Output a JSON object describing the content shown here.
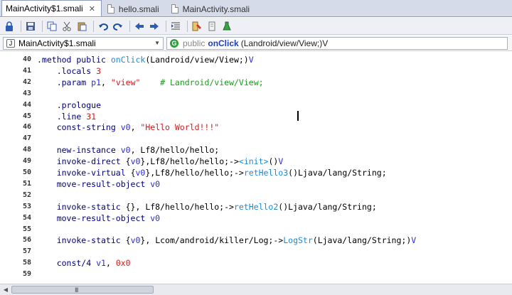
{
  "tabs": [
    {
      "label": "MainActivity$1.smali",
      "active": true
    },
    {
      "label": "hello.smali",
      "active": false
    },
    {
      "label": "MainActivity.smali",
      "active": false
    }
  ],
  "toolbar": {
    "icons": [
      "lock-icon",
      "save-icon",
      "copy-icon",
      "cut-icon",
      "paste-icon",
      "undo-icon",
      "redo-icon",
      "back-icon",
      "forward-icon",
      "indent-icon",
      "format-icon",
      "bookmark-icon",
      "run-icon"
    ]
  },
  "navbar": {
    "class_selector": "MainActivity$1.smali",
    "method_modifier": "public",
    "method_name": "onClick",
    "method_signature": "(Landroid/view/View;)V"
  },
  "editor": {
    "lines": [
      {
        "num": "40",
        "segments": [
          [
            "dir",
            ".method public "
          ],
          [
            "mth",
            "onClick"
          ],
          [
            "plain",
            "(Landroid/view/View;)"
          ],
          [
            "reg",
            "V"
          ]
        ]
      },
      {
        "num": "41",
        "segments": [
          [
            "dir",
            "    .locals "
          ],
          [
            "num",
            "3"
          ]
        ]
      },
      {
        "num": "42",
        "segments": [
          [
            "dir",
            "    .param "
          ],
          [
            "reg",
            "p1"
          ],
          [
            "plain",
            ", "
          ],
          [
            "str",
            "\"view\""
          ],
          [
            "plain",
            "    "
          ],
          [
            "cm",
            "# Landroid/view/View;"
          ]
        ]
      },
      {
        "num": "43",
        "segments": []
      },
      {
        "num": "44",
        "segments": [
          [
            "dir",
            "    .prologue"
          ]
        ]
      },
      {
        "num": "45",
        "segments": [
          [
            "dir",
            "    .line "
          ],
          [
            "num",
            "31"
          ]
        ]
      },
      {
        "num": "46",
        "segments": [
          [
            "kw",
            "    const-string "
          ],
          [
            "reg",
            "v0"
          ],
          [
            "plain",
            ", "
          ],
          [
            "str",
            "\"Hello World!!!\""
          ]
        ]
      },
      {
        "num": "47",
        "segments": []
      },
      {
        "num": "48",
        "segments": [
          [
            "kw",
            "    new-instance "
          ],
          [
            "reg",
            "v0"
          ],
          [
            "plain",
            ", Lf8/hello/hello;"
          ]
        ]
      },
      {
        "num": "49",
        "segments": [
          [
            "kw",
            "    invoke-direct "
          ],
          [
            "plain",
            "{"
          ],
          [
            "reg",
            "v0"
          ],
          [
            "plain",
            "},Lf8/hello/hello;->"
          ],
          [
            "mth",
            "<init>"
          ],
          [
            "plain",
            "()"
          ],
          [
            "reg",
            "V"
          ]
        ]
      },
      {
        "num": "50",
        "segments": [
          [
            "kw",
            "    invoke-virtual "
          ],
          [
            "plain",
            "{"
          ],
          [
            "reg",
            "v0"
          ],
          [
            "plain",
            "},Lf8/hello/hello;->"
          ],
          [
            "mth",
            "retHello3"
          ],
          [
            "plain",
            "()Ljava/lang/String;"
          ]
        ]
      },
      {
        "num": "51",
        "segments": [
          [
            "kw",
            "    move-result-object "
          ],
          [
            "reg",
            "v0"
          ]
        ]
      },
      {
        "num": "52",
        "segments": []
      },
      {
        "num": "53",
        "segments": [
          [
            "kw",
            "    invoke-static "
          ],
          [
            "plain",
            "{}, Lf8/hello/hello;->"
          ],
          [
            "mth",
            "retHello2"
          ],
          [
            "plain",
            "()Ljava/lang/String;"
          ]
        ]
      },
      {
        "num": "54",
        "segments": [
          [
            "kw",
            "    move-result-object "
          ],
          [
            "reg",
            "v0"
          ]
        ]
      },
      {
        "num": "55",
        "segments": []
      },
      {
        "num": "56",
        "segments": [
          [
            "kw",
            "    invoke-static "
          ],
          [
            "plain",
            "{"
          ],
          [
            "reg",
            "v0"
          ],
          [
            "plain",
            "}, Lcom/android/killer/Log;->"
          ],
          [
            "mth",
            "LogStr"
          ],
          [
            "plain",
            "(Ljava/lang/String;)"
          ],
          [
            "reg",
            "V"
          ]
        ]
      },
      {
        "num": "57",
        "segments": []
      },
      {
        "num": "58",
        "segments": [
          [
            "kw",
            "    const/4 "
          ],
          [
            "reg",
            "v1"
          ],
          [
            "plain",
            ", "
          ],
          [
            "num",
            "0x0"
          ]
        ]
      },
      {
        "num": "59",
        "segments": []
      }
    ]
  },
  "scrollbar": {
    "grip": "III"
  }
}
